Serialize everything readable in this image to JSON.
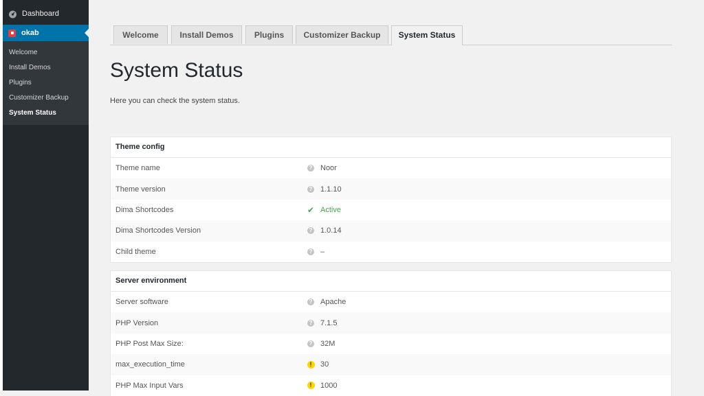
{
  "sidebar": {
    "dashboard_label": "Dashboard",
    "active_menu_label": "okab",
    "submenu": [
      "Welcome",
      "Install Demos",
      "Plugins",
      "Customizer Backup",
      "System Status"
    ]
  },
  "tabs": [
    "Welcome",
    "Install Demos",
    "Plugins",
    "Customizer Backup",
    "System Status"
  ],
  "page": {
    "title": "System Status",
    "description": "Here you can check the system status."
  },
  "theme_config": {
    "heading": "Theme config",
    "rows": [
      {
        "label": "Theme name",
        "value": "Noor",
        "icon": "help-icon"
      },
      {
        "label": "Theme version",
        "value": "1.1.10",
        "icon": "help-icon"
      },
      {
        "label": "Dima Shortcodes",
        "value": "Active",
        "icon": "check-icon"
      },
      {
        "label": "Dima Shortcodes Version",
        "value": "1.0.14",
        "icon": "help-icon"
      },
      {
        "label": "Child theme",
        "value": "–",
        "icon": "help-icon"
      }
    ]
  },
  "server_env": {
    "heading": "Server environment",
    "rows": [
      {
        "label": "Server software",
        "value": "Apache",
        "icon": "help-icon"
      },
      {
        "label": "PHP Version",
        "value": "7.1.5",
        "icon": "help-icon"
      },
      {
        "label": "PHP Post Max Size:",
        "value": "32M",
        "icon": "help-icon"
      },
      {
        "label": "max_execution_time",
        "value": "30",
        "icon": "warning-icon"
      },
      {
        "label": "PHP Max Input Vars",
        "value": "1000",
        "icon": "warning-icon"
      }
    ]
  },
  "colors": {
    "sidebar_bg": "#23282d",
    "submenu_bg": "#32373c",
    "accent": "#0073aa",
    "active_green": "#46a64c",
    "warning_yellow": "#ffd600"
  }
}
